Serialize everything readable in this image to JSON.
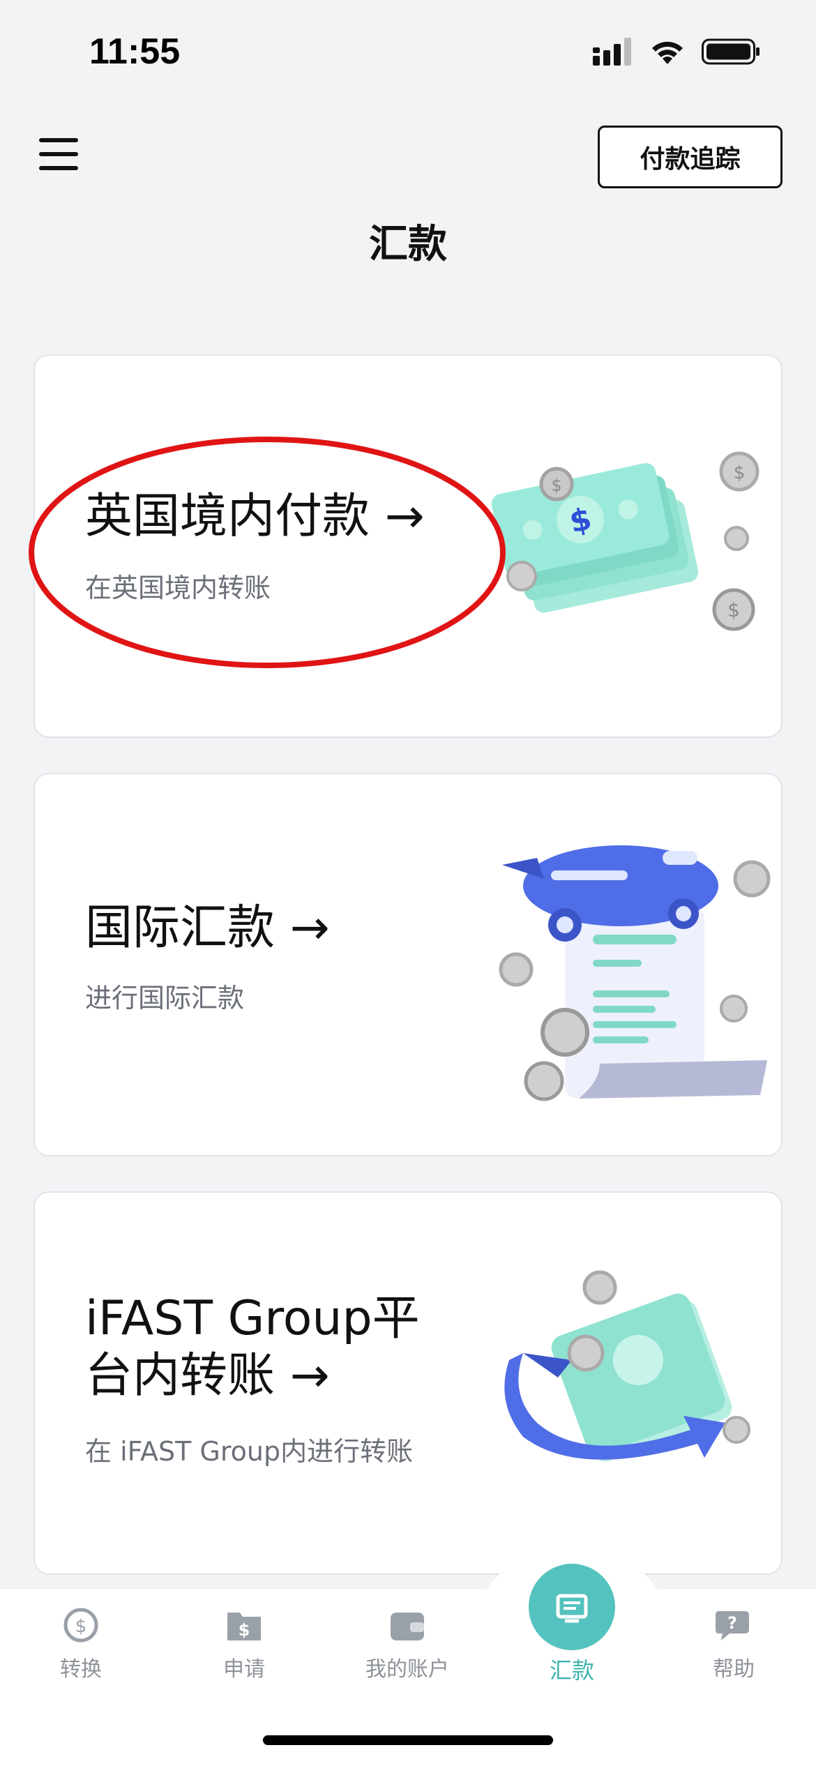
{
  "status_bar": {
    "time": "11:55",
    "icons": [
      "signal-icon",
      "wifi-icon",
      "battery-icon"
    ]
  },
  "header": {
    "menu_icon": "hamburger-menu-icon",
    "track_button_label": "付款追踪",
    "title": "汇款"
  },
  "cards": [
    {
      "title": "英国境内付款 →",
      "subtitle": "在英国境内转账",
      "illustration": "money-stack-icon",
      "annotated": true
    },
    {
      "title": "国际汇款 →",
      "subtitle": "进行国际汇款",
      "illustration": "airplane-receipt-icon"
    },
    {
      "title_line1": "iFAST Group平",
      "title_line2": "台内转账 →",
      "subtitle": "在 iFAST Group内进行转账",
      "illustration": "transfer-arrows-icon"
    }
  ],
  "annotation": {
    "color": "#e01414",
    "shape": "ellipse"
  },
  "bottom_nav": {
    "items": [
      {
        "label": "转换",
        "icon": "currency-exchange-icon"
      },
      {
        "label": "申请",
        "icon": "folder-dollar-icon"
      },
      {
        "label": "我的账户",
        "icon": "wallet-icon"
      },
      {
        "label": "汇款",
        "icon": "remittance-icon",
        "active": true
      },
      {
        "label": "帮助",
        "icon": "help-chat-icon"
      }
    ],
    "active_color": "#54c2be"
  }
}
